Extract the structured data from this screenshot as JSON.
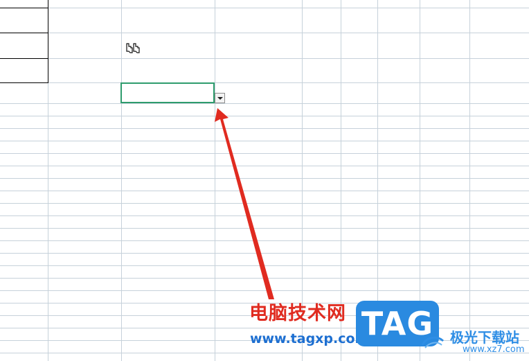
{
  "spreadsheet": {
    "selected_cell_value": "",
    "dropdown_icon": "dropdown-arrow-icon",
    "cursor_icon": "double-hand-pointer-icon",
    "grid_line_color": "#c6d1da",
    "border_color": "#000000",
    "selection_color": "#2e9c6d"
  },
  "annotation": {
    "arrow_color": "#e02b20"
  },
  "watermark": {
    "site_name_cn": "电脑技术网",
    "site_url": "www.tagxp.com",
    "logo_text": "TAG",
    "partner_name_cn": "极光下载站",
    "partner_url": "www.xz7.com"
  }
}
